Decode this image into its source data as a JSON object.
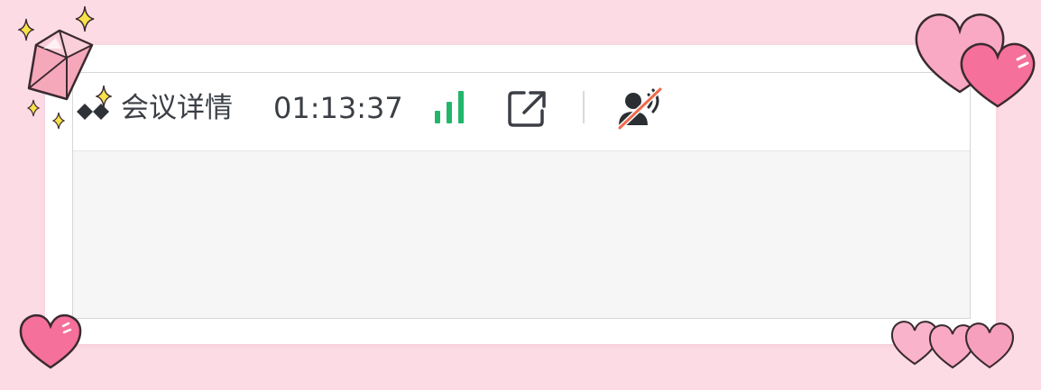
{
  "meeting": {
    "title": "会议详情",
    "timer": "01:13:37"
  },
  "icons": {
    "logo": "tencent-meeting-logo",
    "signal": "network-signal-icon",
    "share": "external-link-icon",
    "profile": "speaker-muted-user-icon"
  },
  "colors": {
    "signal": "#21b66b",
    "muted_slash": "#f06a4a",
    "text": "#3b3f45",
    "frame_background": "#fcdbe5",
    "heart_pink": "#f9a9c3",
    "heart_deep": "#f5709b"
  }
}
